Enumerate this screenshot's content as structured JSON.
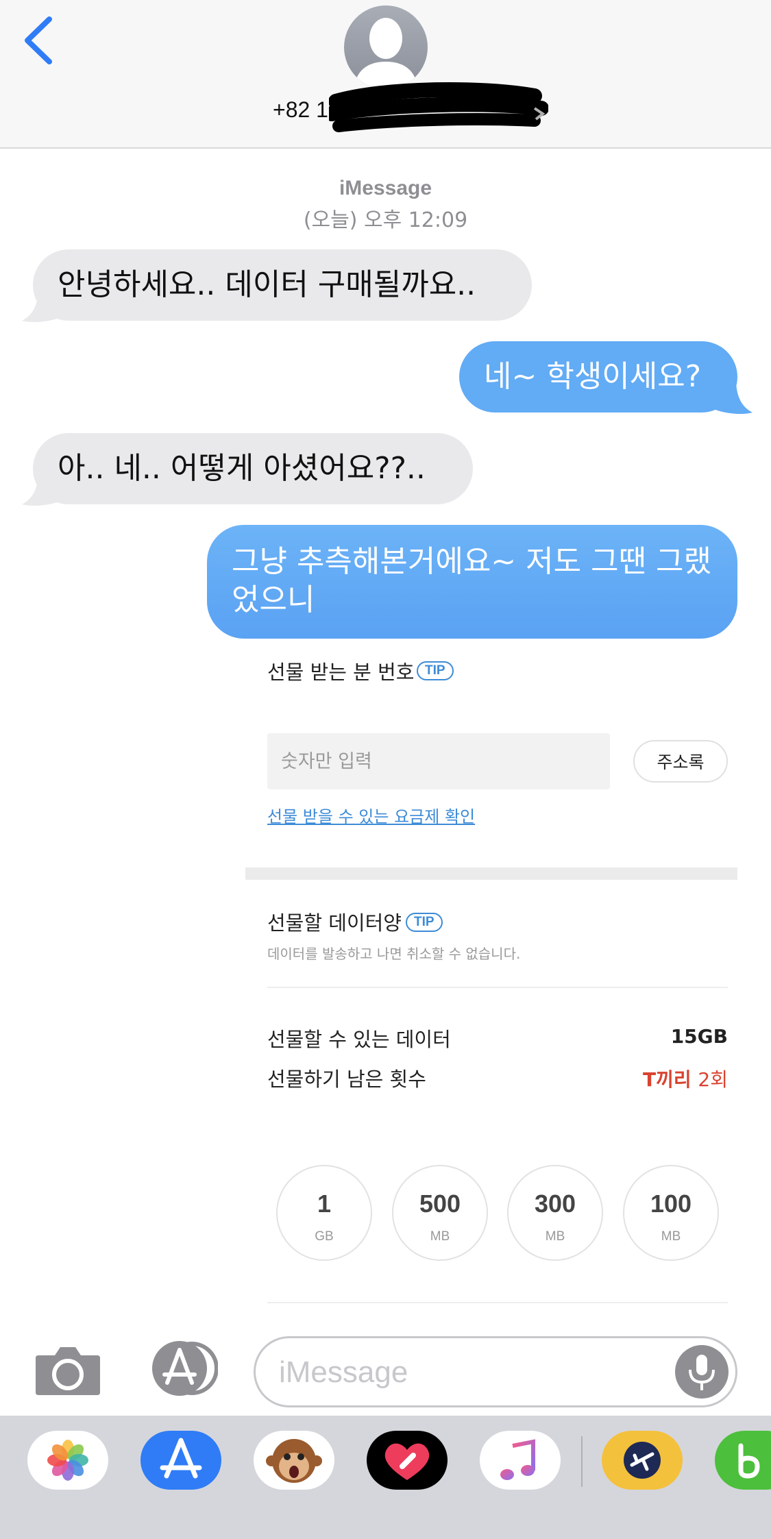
{
  "header": {
    "back_icon": "chevron-left-icon",
    "avatar_icon": "person-silhouette-icon",
    "contact_number": "+82 10"
  },
  "timestamp": {
    "service": "iMessage",
    "time": "(오늘) 오후 12:09"
  },
  "messages": [
    {
      "direction": "incoming",
      "text": "안녕하세요.. 데이터 구매될까요.."
    },
    {
      "direction": "outgoing",
      "text": "네~ 학생이세요?"
    },
    {
      "direction": "incoming",
      "text": "아.. 네.. 어떻게 아셨어요??.."
    },
    {
      "direction": "outgoing",
      "text": "그냥 추측해본거에요~ 저도 그땐 그랬었으니"
    }
  ],
  "gift_card": {
    "recipient_label": "선물 받는 분 번호",
    "tip_label": "TIP",
    "number_placeholder": "숫자만 입력",
    "address_book_label": "주소록",
    "plan_check_link": "선물 받을 수 있는 요금제 확인",
    "data_amount_label": "선물할 데이터양",
    "cancel_note": "데이터를 발송하고 나면 취소할 수 없습니다.",
    "available_label": "선물할 수 있는 데이터",
    "available_value": "15GB",
    "remaining_label": "선물하기 남은 횟수",
    "remaining_brand": "T끼리",
    "remaining_count": "2회",
    "amounts": [
      {
        "value": "1",
        "unit": "GB"
      },
      {
        "value": "500",
        "unit": "MB"
      },
      {
        "value": "300",
        "unit": "MB"
      },
      {
        "value": "100",
        "unit": "MB"
      }
    ]
  },
  "input_bar": {
    "camera_icon": "camera-icon",
    "apps_icon": "app-store-icon",
    "placeholder": "iMessage",
    "mic_icon": "microphone-icon"
  },
  "app_drawer": {
    "apps": [
      "photos-icon",
      "app-store-icon",
      "animoji-icon",
      "digital-touch-icon",
      "music-icon",
      "travel-app-icon",
      "partial-app-icon"
    ]
  },
  "colors": {
    "outgoing_bubble": "#62abf5",
    "incoming_bubble": "#e9e9eb",
    "ios_blue": "#2f7cf6",
    "link_blue": "#3d8bd7",
    "brand_red": "#d9432f"
  }
}
